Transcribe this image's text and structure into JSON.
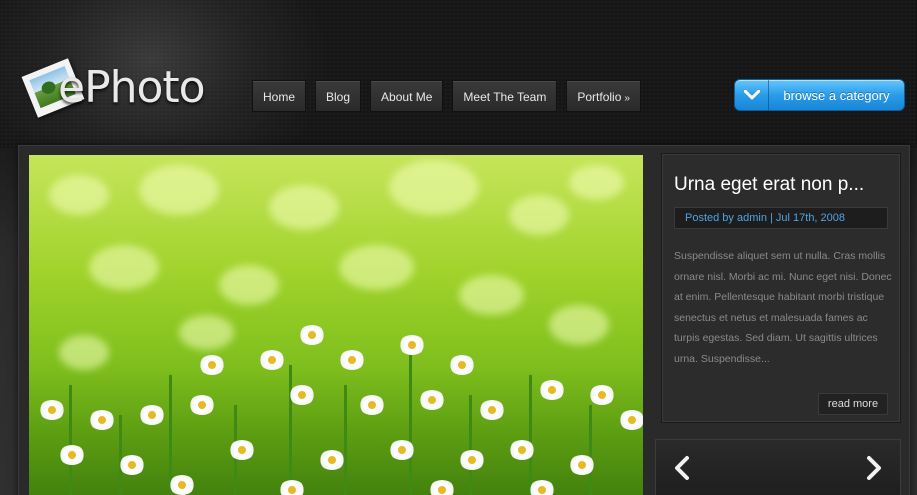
{
  "brand": {
    "logo_text": "ePhoto"
  },
  "nav": {
    "items": [
      {
        "label": "Home"
      },
      {
        "label": "Blog"
      },
      {
        "label": "About Me"
      },
      {
        "label": "Meet The Team"
      },
      {
        "label": "Portfolio",
        "suffix": "»"
      }
    ]
  },
  "browse": {
    "label": "browse a category",
    "icon": "chevron-down-icon"
  },
  "featured": {
    "title": "Urna eget erat non p...",
    "meta": "Posted by admin | Jul 17th, 2008",
    "excerpt": "Suspendisse aliquet sem ut nulla. Cras mollis ornare nisl. Morbi ac mi. Nunc eget nisi. Donec at enim. Pellentesque habitant morbi tristique senectus et netus et malesuada fames ac turpis egestas. Sed diam. Ut sagittis ultrices urna. Suspendisse...",
    "read_more": "read more"
  },
  "slider": {
    "prev_icon": "chevron-left-icon",
    "next_icon": "chevron-right-icon"
  },
  "colors": {
    "accent": "#2a9ce8",
    "meta_link": "#4fa3e3",
    "background": "#151515"
  }
}
